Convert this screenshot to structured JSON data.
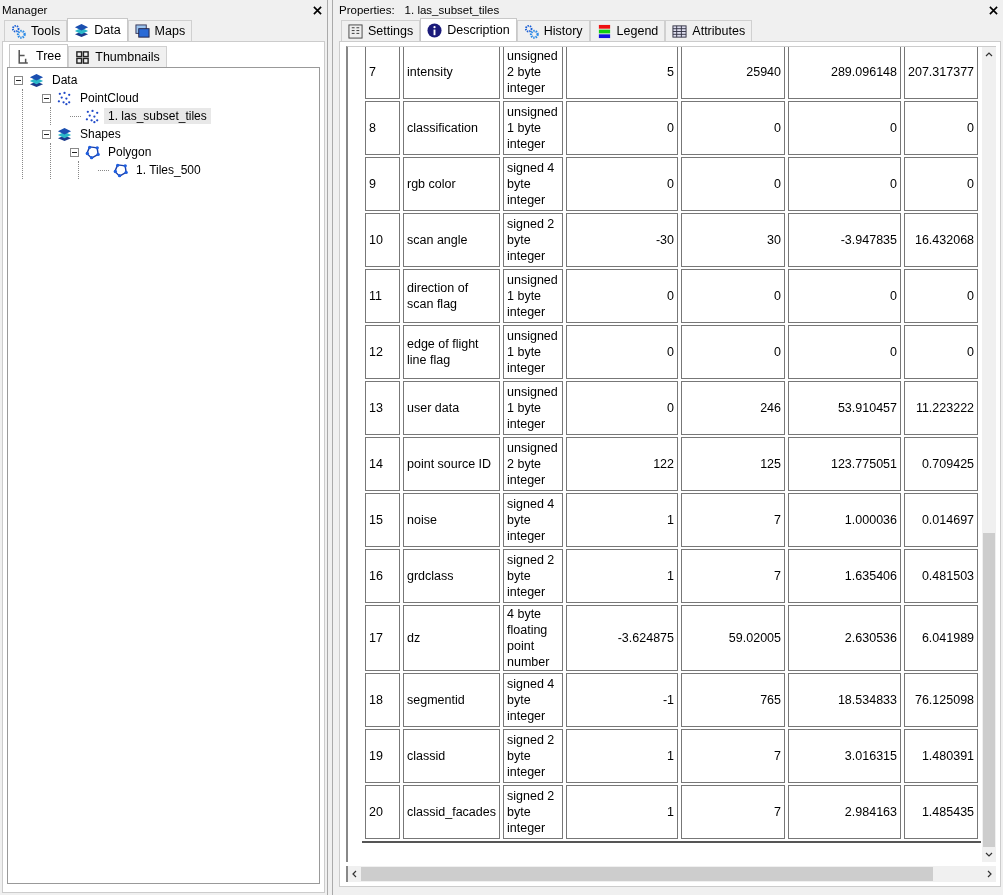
{
  "manager": {
    "title": "Manager",
    "tabs": [
      {
        "label": "Tools",
        "selected": false
      },
      {
        "label": "Data",
        "selected": true
      },
      {
        "label": "Maps",
        "selected": false
      }
    ],
    "subtabs": [
      {
        "label": "Tree",
        "selected": true
      },
      {
        "label": "Thumbnails",
        "selected": false
      }
    ],
    "tree": [
      {
        "label": "Data",
        "kind": "group",
        "selected": false,
        "expanded": true,
        "children": [
          {
            "label": "PointCloud",
            "kind": "pointcloud",
            "selected": false,
            "expanded": true,
            "children": [
              {
                "label": "1. las_subset_tiles",
                "kind": "pointcloud",
                "selected": true
              }
            ]
          },
          {
            "label": "Shapes",
            "kind": "group",
            "selected": false,
            "expanded": true,
            "children": [
              {
                "label": "Polygon",
                "kind": "polygon",
                "selected": false,
                "expanded": true,
                "children": [
                  {
                    "label": "1. Tiles_500",
                    "kind": "polygon",
                    "selected": false
                  }
                ]
              }
            ]
          }
        ]
      }
    ]
  },
  "properties": {
    "title_label": "Properties:",
    "title": "1. las_subset_tiles",
    "tabs": [
      {
        "label": "Settings",
        "selected": false
      },
      {
        "label": "Description",
        "selected": true
      },
      {
        "label": "History",
        "selected": false
      },
      {
        "label": "Legend",
        "selected": false
      },
      {
        "label": "Attributes",
        "selected": false
      }
    ],
    "rows": [
      [
        "7",
        "intensity",
        "unsigned 2 byte integer",
        "5",
        "25940",
        "289.096148",
        "207.317377"
      ],
      [
        "8",
        "classification",
        "unsigned 1 byte integer",
        "0",
        "0",
        "0",
        "0"
      ],
      [
        "9",
        "rgb color",
        "signed 4 byte integer",
        "0",
        "0",
        "0",
        "0"
      ],
      [
        "10",
        "scan angle",
        "signed 2 byte integer",
        "-30",
        "30",
        "-3.947835",
        "16.432068"
      ],
      [
        "11",
        "direction of scan flag",
        "unsigned 1 byte integer",
        "0",
        "0",
        "0",
        "0"
      ],
      [
        "12",
        "edge of flight line flag",
        "unsigned 1 byte integer",
        "0",
        "0",
        "0",
        "0"
      ],
      [
        "13",
        "user data",
        "unsigned 1 byte integer",
        "0",
        "246",
        "53.910457",
        "11.223222"
      ],
      [
        "14",
        "point source ID",
        "unsigned 2 byte integer",
        "122",
        "125",
        "123.775051",
        "0.709425"
      ],
      [
        "15",
        "noise",
        "signed 4 byte integer",
        "1",
        "7",
        "1.000036",
        "0.014697"
      ],
      [
        "16",
        "grdclass",
        "signed 2 byte integer",
        "1",
        "7",
        "1.635406",
        "0.481503"
      ],
      [
        "17",
        "dz",
        "4 byte floating point number",
        "-3.624875",
        "59.02005",
        "2.630536",
        "6.041989"
      ],
      [
        "18",
        "segmentid",
        "signed 4 byte integer",
        "-1",
        "765",
        "18.534833",
        "76.125098"
      ],
      [
        "19",
        "classid",
        "signed 2 byte integer",
        "1",
        "7",
        "3.016315",
        "1.480391"
      ],
      [
        "20",
        "classid_facades",
        "signed 2 byte integer",
        "1",
        "7",
        "2.984163",
        "1.485435"
      ]
    ]
  }
}
